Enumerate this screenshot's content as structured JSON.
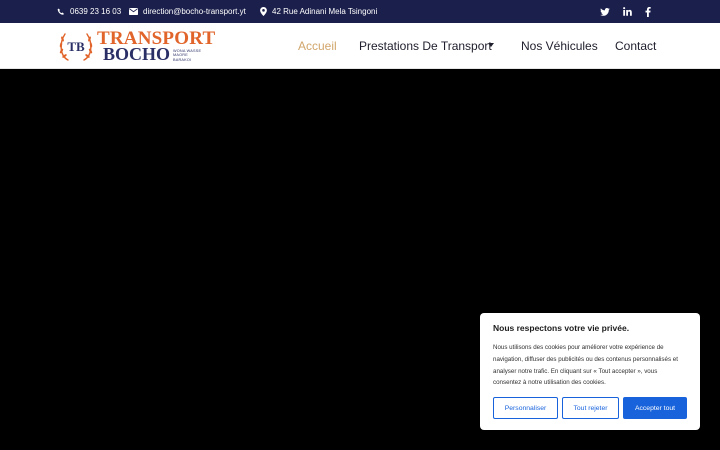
{
  "topbar": {
    "phone": "0639 23 16 03",
    "email": "direction@bocho-transport.yt",
    "address": "42 Rue Adinani Mela Tsingoni"
  },
  "logo": {
    "monogram": "TB",
    "line1": "TRANSPORT",
    "line2": "BOCHO",
    "tagline": [
      "WONA WASSE",
      "MAORE",
      "BARAKOI"
    ]
  },
  "nav": {
    "home": "Accueil",
    "services": "Prestations De Transport",
    "vehicles": "Nos Véhicules",
    "contact": "Contact"
  },
  "cookie": {
    "title": "Nous respectons votre vie privée.",
    "text": "Nous utilisons des cookies pour améliorer votre expérience de navigation, diffuser des publicités ou des contenus personnalisés et analyser notre trafic. En cliquant sur « Tout accepter », vous consentez à notre utilisation des cookies.",
    "customize": "Personnaliser",
    "reject": "Tout rejeter",
    "accept": "Accepter tout"
  },
  "colors": {
    "topbar": "#1b1f4b",
    "accent_orange": "#e1642a",
    "brand_navy": "#2a2f66",
    "nav_active": "#d1a56b",
    "cookie_blue": "#1863dc"
  },
  "icons": {
    "phone": "phone-icon",
    "email": "envelope-icon",
    "address": "map-pin-icon",
    "twitter": "twitter-icon",
    "linkedin": "linkedin-icon",
    "facebook": "facebook-icon"
  }
}
